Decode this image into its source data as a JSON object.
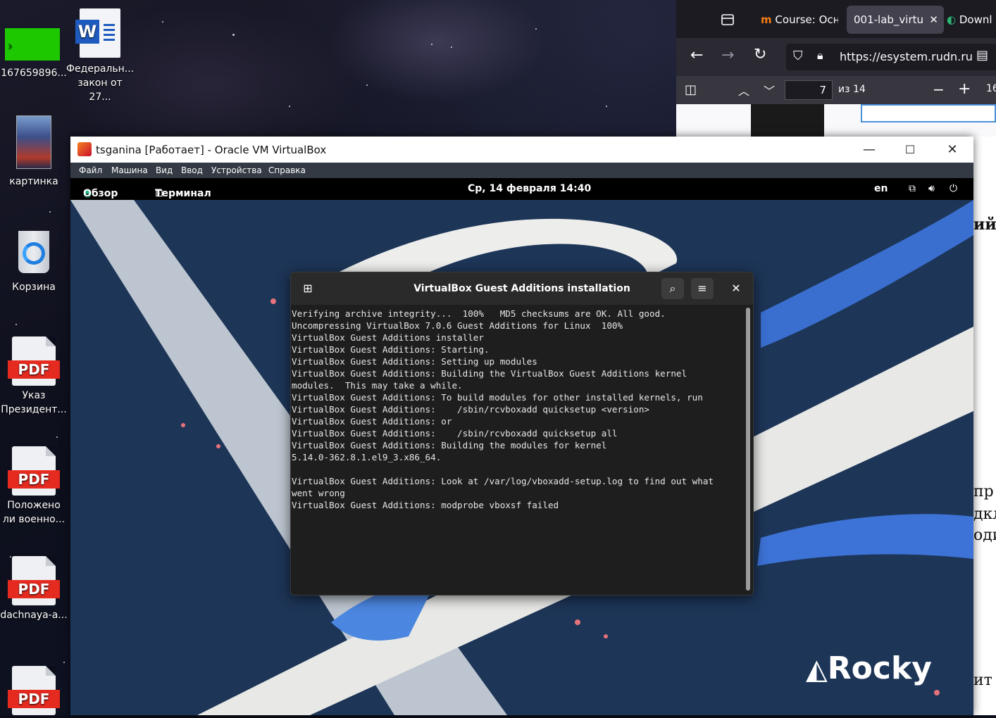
{
  "desktop": {
    "icons": [
      {
        "label": "167659896..."
      },
      {
        "label": "Федеральн...",
        "label2": "закон от 27..."
      },
      {
        "label": "картинка"
      },
      {
        "label": "Корзина"
      },
      {
        "label": "Указ",
        "label2": "Президент..."
      },
      {
        "label": "Положено",
        "label2": "ли военно..."
      },
      {
        "label": "dachnaya-a..."
      }
    ],
    "pdf_tag": "PDF"
  },
  "browser": {
    "tabs": [
      {
        "label": "Course: Осн"
      },
      {
        "label": "001-lab_virtu"
      },
      {
        "label": "Downl"
      }
    ],
    "url": "https://esystem.rudn.ru",
    "pdf_page": "7",
    "pdf_total": "из 14",
    "zoom_partial": "16"
  },
  "doc_fragments": [
    "ийс",
    "пр",
    "дкл",
    "оди",
    "ит"
  ],
  "vbox": {
    "title": "tsganina [Работает] - Oracle VM VirtualBox",
    "menu": [
      "Файл",
      "Машина",
      "Вид",
      "Ввод",
      "Устройства",
      "Справка"
    ]
  },
  "gnome": {
    "activities": "Обзор",
    "app": "Терминал",
    "clock": "Ср, 14 февраля 14:40",
    "lang": "en"
  },
  "terminal": {
    "title": "VirtualBox Guest Additions installation",
    "lines": [
      "Verifying archive integrity...  100%   MD5 checksums are OK. All good.",
      "Uncompressing VirtualBox 7.0.6 Guest Additions for Linux  100%",
      "VirtualBox Guest Additions installer",
      "VirtualBox Guest Additions: Starting.",
      "VirtualBox Guest Additions: Setting up modules",
      "VirtualBox Guest Additions: Building the VirtualBox Guest Additions kernel",
      "modules.  This may take a while.",
      "VirtualBox Guest Additions: To build modules for other installed kernels, run",
      "VirtualBox Guest Additions:    /sbin/rcvboxadd quicksetup <version>",
      "VirtualBox Guest Additions: or",
      "VirtualBox Guest Additions:    /sbin/rcvboxadd quicksetup all",
      "VirtualBox Guest Additions: Building the modules for kernel",
      "5.14.0-362.8.1.el9_3.x86_64.",
      "",
      "VirtualBox Guest Additions: Look at /var/log/vboxadd-setup.log to find out what",
      "went wrong",
      "VirtualBox Guest Additions: modprobe vboxsf failed"
    ]
  },
  "wallpaper": {
    "brand": "Rocky"
  },
  "colors": {
    "guest_bg": "#1d3557",
    "pdf_red": "#e52b20",
    "accent_green": "#10b981"
  }
}
